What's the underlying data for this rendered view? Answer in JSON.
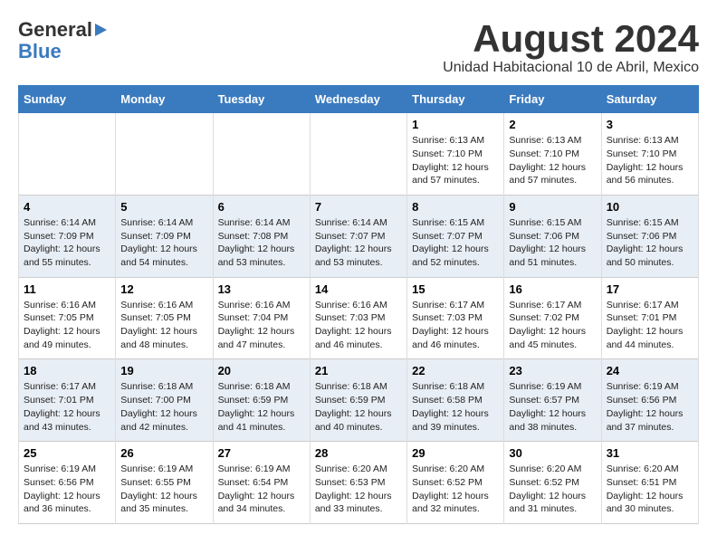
{
  "header": {
    "logo_line1": "General",
    "logo_line2": "Blue",
    "main_title": "August 2024",
    "subtitle": "Unidad Habitacional 10 de Abril, Mexico"
  },
  "days_of_week": [
    "Sunday",
    "Monday",
    "Tuesday",
    "Wednesday",
    "Thursday",
    "Friday",
    "Saturday"
  ],
  "weeks": [
    [
      {
        "day": "",
        "content": ""
      },
      {
        "day": "",
        "content": ""
      },
      {
        "day": "",
        "content": ""
      },
      {
        "day": "",
        "content": ""
      },
      {
        "day": "1",
        "content": "Sunrise: 6:13 AM\nSunset: 7:10 PM\nDaylight: 12 hours\nand 57 minutes."
      },
      {
        "day": "2",
        "content": "Sunrise: 6:13 AM\nSunset: 7:10 PM\nDaylight: 12 hours\nand 57 minutes."
      },
      {
        "day": "3",
        "content": "Sunrise: 6:13 AM\nSunset: 7:10 PM\nDaylight: 12 hours\nand 56 minutes."
      }
    ],
    [
      {
        "day": "4",
        "content": "Sunrise: 6:14 AM\nSunset: 7:09 PM\nDaylight: 12 hours\nand 55 minutes."
      },
      {
        "day": "5",
        "content": "Sunrise: 6:14 AM\nSunset: 7:09 PM\nDaylight: 12 hours\nand 54 minutes."
      },
      {
        "day": "6",
        "content": "Sunrise: 6:14 AM\nSunset: 7:08 PM\nDaylight: 12 hours\nand 53 minutes."
      },
      {
        "day": "7",
        "content": "Sunrise: 6:14 AM\nSunset: 7:07 PM\nDaylight: 12 hours\nand 53 minutes."
      },
      {
        "day": "8",
        "content": "Sunrise: 6:15 AM\nSunset: 7:07 PM\nDaylight: 12 hours\nand 52 minutes."
      },
      {
        "day": "9",
        "content": "Sunrise: 6:15 AM\nSunset: 7:06 PM\nDaylight: 12 hours\nand 51 minutes."
      },
      {
        "day": "10",
        "content": "Sunrise: 6:15 AM\nSunset: 7:06 PM\nDaylight: 12 hours\nand 50 minutes."
      }
    ],
    [
      {
        "day": "11",
        "content": "Sunrise: 6:16 AM\nSunset: 7:05 PM\nDaylight: 12 hours\nand 49 minutes."
      },
      {
        "day": "12",
        "content": "Sunrise: 6:16 AM\nSunset: 7:05 PM\nDaylight: 12 hours\nand 48 minutes."
      },
      {
        "day": "13",
        "content": "Sunrise: 6:16 AM\nSunset: 7:04 PM\nDaylight: 12 hours\nand 47 minutes."
      },
      {
        "day": "14",
        "content": "Sunrise: 6:16 AM\nSunset: 7:03 PM\nDaylight: 12 hours\nand 46 minutes."
      },
      {
        "day": "15",
        "content": "Sunrise: 6:17 AM\nSunset: 7:03 PM\nDaylight: 12 hours\nand 46 minutes."
      },
      {
        "day": "16",
        "content": "Sunrise: 6:17 AM\nSunset: 7:02 PM\nDaylight: 12 hours\nand 45 minutes."
      },
      {
        "day": "17",
        "content": "Sunrise: 6:17 AM\nSunset: 7:01 PM\nDaylight: 12 hours\nand 44 minutes."
      }
    ],
    [
      {
        "day": "18",
        "content": "Sunrise: 6:17 AM\nSunset: 7:01 PM\nDaylight: 12 hours\nand 43 minutes."
      },
      {
        "day": "19",
        "content": "Sunrise: 6:18 AM\nSunset: 7:00 PM\nDaylight: 12 hours\nand 42 minutes."
      },
      {
        "day": "20",
        "content": "Sunrise: 6:18 AM\nSunset: 6:59 PM\nDaylight: 12 hours\nand 41 minutes."
      },
      {
        "day": "21",
        "content": "Sunrise: 6:18 AM\nSunset: 6:59 PM\nDaylight: 12 hours\nand 40 minutes."
      },
      {
        "day": "22",
        "content": "Sunrise: 6:18 AM\nSunset: 6:58 PM\nDaylight: 12 hours\nand 39 minutes."
      },
      {
        "day": "23",
        "content": "Sunrise: 6:19 AM\nSunset: 6:57 PM\nDaylight: 12 hours\nand 38 minutes."
      },
      {
        "day": "24",
        "content": "Sunrise: 6:19 AM\nSunset: 6:56 PM\nDaylight: 12 hours\nand 37 minutes."
      }
    ],
    [
      {
        "day": "25",
        "content": "Sunrise: 6:19 AM\nSunset: 6:56 PM\nDaylight: 12 hours\nand 36 minutes."
      },
      {
        "day": "26",
        "content": "Sunrise: 6:19 AM\nSunset: 6:55 PM\nDaylight: 12 hours\nand 35 minutes."
      },
      {
        "day": "27",
        "content": "Sunrise: 6:19 AM\nSunset: 6:54 PM\nDaylight: 12 hours\nand 34 minutes."
      },
      {
        "day": "28",
        "content": "Sunrise: 6:20 AM\nSunset: 6:53 PM\nDaylight: 12 hours\nand 33 minutes."
      },
      {
        "day": "29",
        "content": "Sunrise: 6:20 AM\nSunset: 6:52 PM\nDaylight: 12 hours\nand 32 minutes."
      },
      {
        "day": "30",
        "content": "Sunrise: 6:20 AM\nSunset: 6:52 PM\nDaylight: 12 hours\nand 31 minutes."
      },
      {
        "day": "31",
        "content": "Sunrise: 6:20 AM\nSunset: 6:51 PM\nDaylight: 12 hours\nand 30 minutes."
      }
    ]
  ]
}
